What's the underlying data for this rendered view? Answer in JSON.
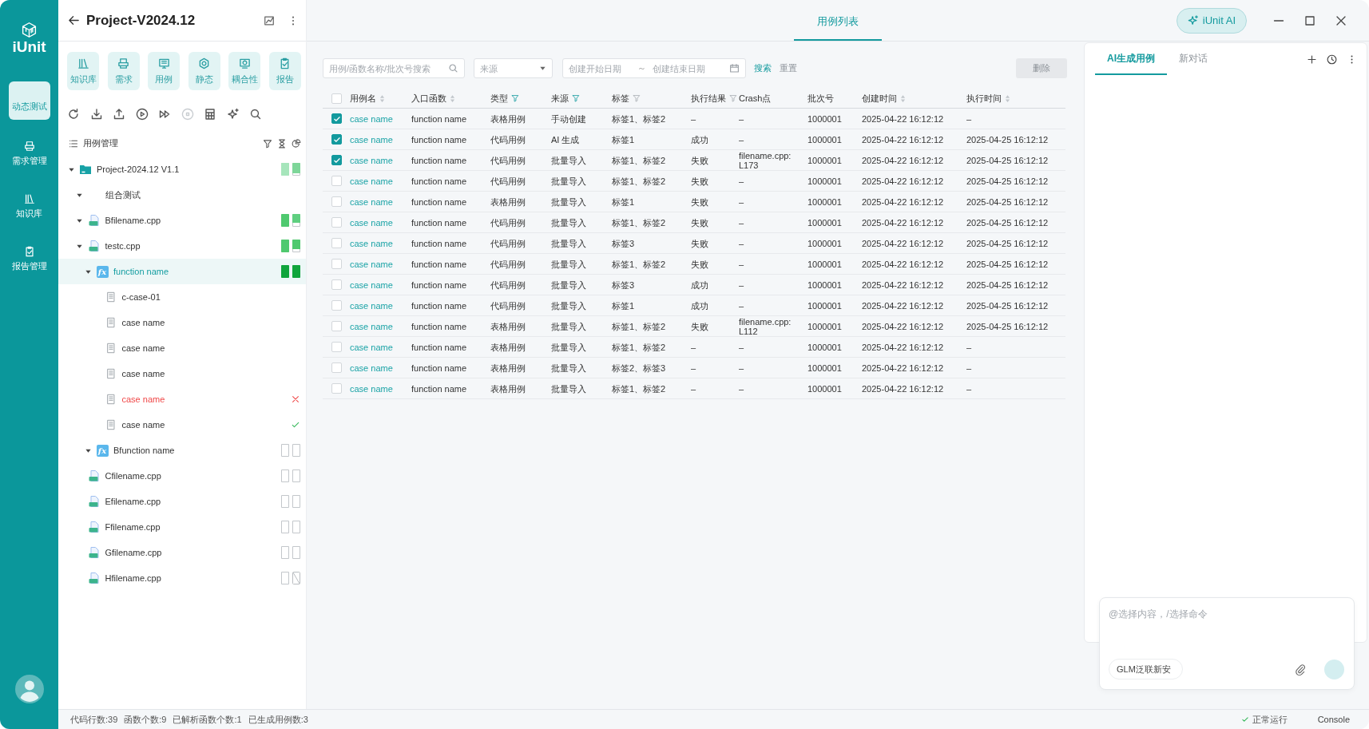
{
  "app": {
    "logo": "iUnit"
  },
  "nav": [
    {
      "label": "动态测试",
      "selected": true
    },
    {
      "label": "需求管理",
      "selected": false
    },
    {
      "label": "知识库",
      "selected": false
    },
    {
      "label": "报告管理",
      "selected": false
    }
  ],
  "project": {
    "title": "Project-V2024.12"
  },
  "modules": [
    {
      "label": "知识库"
    },
    {
      "label": "需求"
    },
    {
      "label": "用例"
    },
    {
      "label": "静态"
    },
    {
      "label": "耦合性"
    },
    {
      "label": "报告"
    }
  ],
  "tool_buttons": [
    {
      "disabled": false
    },
    {
      "disabled": false
    },
    {
      "disabled": false
    },
    {
      "disabled": false
    },
    {
      "disabled": false
    },
    {
      "disabled": true
    },
    {
      "disabled": false
    },
    {
      "disabled": false
    },
    {
      "disabled": false
    }
  ],
  "case_tree": {
    "title": "用例管理",
    "nodes": [
      {
        "kind": "project",
        "label": "Project-2024.12 V1.1",
        "expanded": true,
        "selected": false,
        "bars": [
          {
            "kind": "meter",
            "level": 1,
            "color": "#a6e5bb"
          },
          {
            "kind": "meter",
            "level": 0.8,
            "color": "#7ed699"
          }
        ],
        "children": [
          {
            "kind": "group",
            "label": "组合测试",
            "expanded": true,
            "selected": false
          },
          {
            "kind": "file",
            "label": "Bfilename.cpp",
            "expanded": true,
            "selected": false,
            "bars": [
              {
                "kind": "meter",
                "level": 1,
                "color": "#4fc96f"
              },
              {
                "kind": "meter",
                "level": 0.7,
                "color": "#5fcf80"
              }
            ]
          },
          {
            "kind": "file",
            "label": "testc.cpp",
            "expanded": true,
            "selected": false,
            "bars": [
              {
                "kind": "meter",
                "level": 1,
                "color": "#4fc96f"
              },
              {
                "kind": "meter",
                "level": 0.75,
                "color": "#4fc96f"
              }
            ],
            "children": [
              {
                "kind": "function",
                "badge": "fx",
                "label": "function name",
                "expanded": true,
                "selected": true,
                "bars": [
                  {
                    "kind": "meter",
                    "level": 1,
                    "color": "#10a53c"
                  },
                  {
                    "kind": "meter",
                    "level": 1,
                    "color": "#10a53c"
                  }
                ],
                "children": [
                  {
                    "kind": "case",
                    "label": "c-case-01",
                    "selected": false,
                    "failed": false,
                    "passed": false
                  },
                  {
                    "kind": "case",
                    "label": "case name",
                    "selected": false,
                    "failed": false,
                    "passed": false
                  },
                  {
                    "kind": "case",
                    "label": "case name",
                    "selected": false,
                    "failed": false,
                    "passed": false
                  },
                  {
                    "kind": "case",
                    "label": "case name",
                    "selected": false,
                    "failed": false,
                    "passed": false
                  },
                  {
                    "kind": "case",
                    "label": "case name",
                    "selected": false,
                    "failed": true,
                    "passed": false
                  },
                  {
                    "kind": "case",
                    "label": "case name",
                    "selected": false,
                    "failed": false,
                    "passed": true
                  }
                ]
              },
              {
                "kind": "function",
                "badge": "fx",
                "label": "Bfunction name",
                "expanded": true,
                "selected": false,
                "bars": [
                  {
                    "kind": "empty"
                  },
                  {
                    "kind": "empty"
                  }
                ]
              }
            ]
          },
          {
            "kind": "file",
            "label": "Cfilename.cpp",
            "expanded": false,
            "selected": false,
            "bars": [
              {
                "kind": "empty"
              },
              {
                "kind": "empty"
              }
            ]
          },
          {
            "kind": "file",
            "label": "Efilename.cpp",
            "expanded": false,
            "selected": false,
            "bars": [
              {
                "kind": "empty"
              },
              {
                "kind": "empty"
              }
            ]
          },
          {
            "kind": "file",
            "label": "Ffilename.cpp",
            "expanded": false,
            "selected": false,
            "bars": [
              {
                "kind": "empty"
              },
              {
                "kind": "empty"
              }
            ]
          },
          {
            "kind": "file",
            "label": "Gfilename.cpp",
            "expanded": false,
            "selected": false,
            "bars": [
              {
                "kind": "empty"
              },
              {
                "kind": "empty"
              }
            ]
          },
          {
            "kind": "file",
            "label": "Hfilename.cpp",
            "expanded": false,
            "selected": false,
            "bars": [
              {
                "kind": "empty"
              },
              {
                "kind": "na"
              }
            ]
          }
        ]
      }
    ]
  },
  "main_tabs": [
    {
      "label": "用例列表",
      "selected": true
    }
  ],
  "ai_button": {
    "label": "iUnit AI"
  },
  "filters": {
    "search": {
      "placeholder": "用例/函数名称/批次号搜索"
    },
    "source": {
      "placeholder": "来源"
    },
    "start_date": {
      "placeholder": "创建开始日期"
    },
    "range_separator": "～",
    "end_date": {
      "placeholder": "创建结束日期"
    },
    "search_link": "搜索",
    "reset_link": "重置",
    "delete_button": "删除"
  },
  "table": {
    "all_checked": false,
    "columns": [
      {
        "label": "用例名",
        "sortable": true,
        "filter": false
      },
      {
        "label": "入口函数",
        "sortable": true,
        "filter": false
      },
      {
        "label": "类型",
        "sortable": false,
        "filter": true,
        "filter_active": true
      },
      {
        "label": "来源",
        "sortable": false,
        "filter": true,
        "filter_active": true
      },
      {
        "label": "标签",
        "sortable": false,
        "filter": true,
        "filter_active": false
      },
      {
        "label": "执行结果",
        "sortable": false,
        "filter": true,
        "filter_active": false
      },
      {
        "label": "Crash点",
        "sortable": false,
        "filter": false
      },
      {
        "label": "批次号",
        "sortable": false,
        "filter": false
      },
      {
        "label": "创建时间",
        "sortable": true,
        "filter": false
      },
      {
        "label": "执行时间",
        "sortable": true,
        "filter": false
      }
    ],
    "rows": [
      {
        "checked": true,
        "name": "case name",
        "function": "function name",
        "type": "表格用例",
        "source": "手动创建",
        "tags": "标签1、标签2",
        "result": "–",
        "crash": "–",
        "batch": "1000001",
        "created": "2025-04-22 16:12:12",
        "executed": "–"
      },
      {
        "checked": true,
        "name": "case name",
        "function": "function name",
        "type": "代码用例",
        "source": "AI 生成",
        "tags": "标签1",
        "result": "成功",
        "crash": "–",
        "batch": "1000001",
        "created": "2025-04-22 16:12:12",
        "executed": "2025-04-25 16:12:12"
      },
      {
        "checked": true,
        "name": "case name",
        "function": "function name",
        "type": "代码用例",
        "source": "批量导入",
        "tags": "标签1、标签2",
        "result": "失败",
        "crash": "filename.cpp: L173",
        "batch": "1000001",
        "created": "2025-04-22 16:12:12",
        "executed": "2025-04-25 16:12:12"
      },
      {
        "checked": false,
        "name": "case name",
        "function": "function name",
        "type": "代码用例",
        "source": "批量导入",
        "tags": "标签1、标签2",
        "result": "失败",
        "crash": "–",
        "batch": "1000001",
        "created": "2025-04-22 16:12:12",
        "executed": "2025-04-25 16:12:12"
      },
      {
        "checked": false,
        "name": "case name",
        "function": "function name",
        "type": "表格用例",
        "source": "批量导入",
        "tags": "标签1",
        "result": "失败",
        "crash": "–",
        "batch": "1000001",
        "created": "2025-04-22 16:12:12",
        "executed": "2025-04-25 16:12:12"
      },
      {
        "checked": false,
        "name": "case name",
        "function": "function name",
        "type": "代码用例",
        "source": "批量导入",
        "tags": "标签1、标签2",
        "result": "失败",
        "crash": "–",
        "batch": "1000001",
        "created": "2025-04-22 16:12:12",
        "executed": "2025-04-25 16:12:12"
      },
      {
        "checked": false,
        "name": "case name",
        "function": "function name",
        "type": "代码用例",
        "source": "批量导入",
        "tags": "标签3",
        "result": "失败",
        "crash": "–",
        "batch": "1000001",
        "created": "2025-04-22 16:12:12",
        "executed": "2025-04-25 16:12:12"
      },
      {
        "checked": false,
        "name": "case name",
        "function": "function name",
        "type": "代码用例",
        "source": "批量导入",
        "tags": "标签1、标签2",
        "result": "失败",
        "crash": "–",
        "batch": "1000001",
        "created": "2025-04-22 16:12:12",
        "executed": "2025-04-25 16:12:12"
      },
      {
        "checked": false,
        "name": "case name",
        "function": "function name",
        "type": "代码用例",
        "source": "批量导入",
        "tags": "标签3",
        "result": "成功",
        "crash": "–",
        "batch": "1000001",
        "created": "2025-04-22 16:12:12",
        "executed": "2025-04-25 16:12:12"
      },
      {
        "checked": false,
        "name": "case name",
        "function": "function name",
        "type": "代码用例",
        "source": "批量导入",
        "tags": "标签1",
        "result": "成功",
        "crash": "–",
        "batch": "1000001",
        "created": "2025-04-22 16:12:12",
        "executed": "2025-04-25 16:12:12"
      },
      {
        "checked": false,
        "name": "case name",
        "function": "function name",
        "type": "表格用例",
        "source": "批量导入",
        "tags": "标签1、标签2",
        "result": "失败",
        "crash": "filename.cpp: L112",
        "batch": "1000001",
        "created": "2025-04-22 16:12:12",
        "executed": "2025-04-25 16:12:12"
      },
      {
        "checked": false,
        "name": "case name",
        "function": "function name",
        "type": "表格用例",
        "source": "批量导入",
        "tags": "标签1、标签2",
        "result": "–",
        "crash": "–",
        "batch": "1000001",
        "created": "2025-04-22 16:12:12",
        "executed": "–"
      },
      {
        "checked": false,
        "name": "case name",
        "function": "function name",
        "type": "表格用例",
        "source": "批量导入",
        "tags": "标签2、标签3",
        "result": "–",
        "crash": "–",
        "batch": "1000001",
        "created": "2025-04-22 16:12:12",
        "executed": "–"
      },
      {
        "checked": false,
        "name": "case name",
        "function": "function name",
        "type": "表格用例",
        "source": "批量导入",
        "tags": "标签1、标签2",
        "result": "–",
        "crash": "–",
        "batch": "1000001",
        "created": "2025-04-22 16:12:12",
        "executed": "–"
      }
    ]
  },
  "ai_panel": {
    "tabs": [
      {
        "label": "AI生成用例",
        "selected": true
      },
      {
        "label": "新对话",
        "selected": false
      }
    ],
    "input": {
      "placeholder": "@选择内容，/选择命令"
    },
    "model": "GLM泛联新安"
  },
  "status_bar": {
    "stats": [
      "代码行数:39",
      "函数个数:9",
      "已解析函数个数:1",
      "已生成用例数:3"
    ],
    "run_status": "正常运行",
    "console": "Console"
  }
}
